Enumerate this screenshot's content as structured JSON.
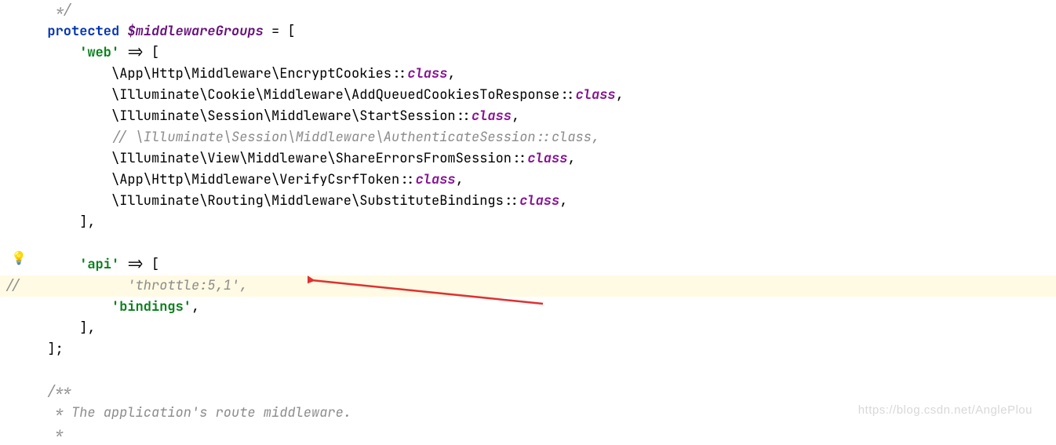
{
  "gutter": {
    "bulb_icon": "💡",
    "bulb_line": 12
  },
  "lines": [
    {
      "tokens": [
        {
          "t": "doc",
          "v": "   */"
        }
      ]
    },
    {
      "tokens": [
        {
          "t": "plain",
          "v": "  "
        },
        {
          "t": "kw",
          "v": "protected"
        },
        {
          "t": "plain",
          "v": " "
        },
        {
          "t": "var",
          "v": "$middlewareGroups"
        },
        {
          "t": "plain",
          "v": " = ["
        }
      ]
    },
    {
      "tokens": [
        {
          "t": "plain",
          "v": "      "
        },
        {
          "t": "str",
          "v": "'web'"
        },
        {
          "t": "plain",
          "v": " => ["
        }
      ]
    },
    {
      "tokens": [
        {
          "t": "plain",
          "v": "          \\App\\Http\\Middleware\\EncryptCookies::"
        },
        {
          "t": "cls",
          "v": "class"
        },
        {
          "t": "plain",
          "v": ","
        }
      ]
    },
    {
      "tokens": [
        {
          "t": "plain",
          "v": "          \\Illuminate\\Cookie\\Middleware\\AddQueuedCookiesToResponse::"
        },
        {
          "t": "cls",
          "v": "class"
        },
        {
          "t": "plain",
          "v": ","
        }
      ]
    },
    {
      "tokens": [
        {
          "t": "plain",
          "v": "          \\Illuminate\\Session\\Middleware\\StartSession::"
        },
        {
          "t": "cls",
          "v": "class"
        },
        {
          "t": "plain",
          "v": ","
        }
      ]
    },
    {
      "tokens": [
        {
          "t": "plain",
          "v": "          "
        },
        {
          "t": "comment",
          "v": "// \\Illuminate\\Session\\Middleware\\AuthenticateSession::class,"
        }
      ]
    },
    {
      "tokens": [
        {
          "t": "plain",
          "v": "          \\Illuminate\\View\\Middleware\\ShareErrorsFromSession::"
        },
        {
          "t": "cls",
          "v": "class"
        },
        {
          "t": "plain",
          "v": ","
        }
      ]
    },
    {
      "tokens": [
        {
          "t": "plain",
          "v": "          \\App\\Http\\Middleware\\VerifyCsrfToken::"
        },
        {
          "t": "cls",
          "v": "class"
        },
        {
          "t": "plain",
          "v": ","
        }
      ]
    },
    {
      "tokens": [
        {
          "t": "plain",
          "v": "          \\Illuminate\\Routing\\Middleware\\SubstituteBindings::"
        },
        {
          "t": "cls",
          "v": "class"
        },
        {
          "t": "plain",
          "v": ","
        }
      ]
    },
    {
      "tokens": [
        {
          "t": "plain",
          "v": "      ],"
        }
      ]
    },
    {
      "tokens": [
        {
          "t": "plain",
          "v": ""
        }
      ]
    },
    {
      "tokens": [
        {
          "t": "plain",
          "v": "      "
        },
        {
          "t": "str",
          "v": "'api'"
        },
        {
          "t": "plain",
          "v": " => ["
        }
      ]
    },
    {
      "hl": true,
      "commentMark": "//",
      "tokens": [
        {
          "t": "plain",
          "v": "            "
        },
        {
          "t": "comment",
          "v": "'throttle:5,1',"
        }
      ]
    },
    {
      "tokens": [
        {
          "t": "plain",
          "v": "          "
        },
        {
          "t": "str",
          "v": "'bindings'"
        },
        {
          "t": "plain",
          "v": ","
        }
      ]
    },
    {
      "tokens": [
        {
          "t": "plain",
          "v": "      ],"
        }
      ]
    },
    {
      "tokens": [
        {
          "t": "plain",
          "v": "  ];"
        }
      ]
    },
    {
      "tokens": [
        {
          "t": "plain",
          "v": ""
        }
      ]
    },
    {
      "tokens": [
        {
          "t": "doc",
          "v": "  /**"
        }
      ]
    },
    {
      "tokens": [
        {
          "t": "doc",
          "v": "   * The application's route middleware."
        }
      ]
    },
    {
      "tokens": [
        {
          "t": "doc",
          "v": "   *"
        }
      ]
    }
  ],
  "watermark": "https://blog.csdn.net/AnglePlou"
}
